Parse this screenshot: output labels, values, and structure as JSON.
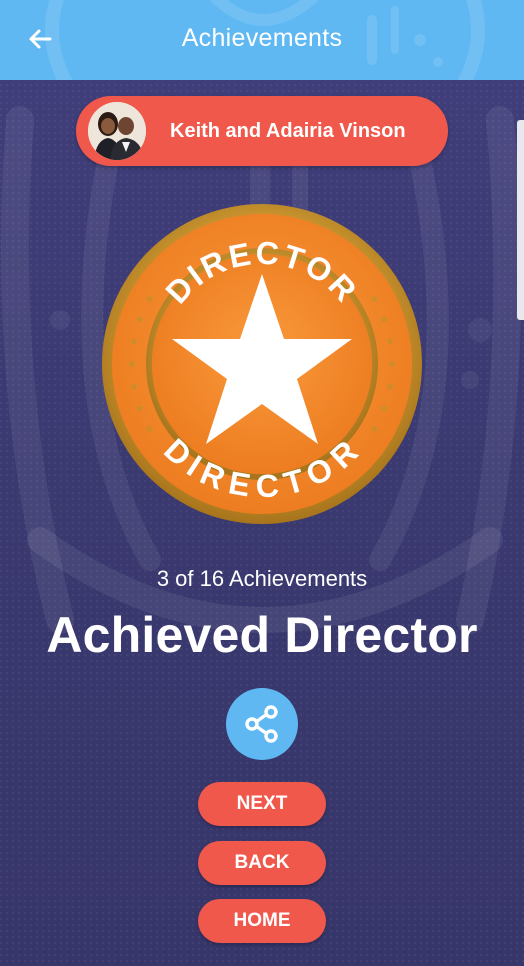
{
  "header": {
    "title": "Achievements",
    "back_icon": "arrow-left-icon",
    "color": "#5fb8f2"
  },
  "user": {
    "name": "Keith and Adairia Vinson",
    "avatar_icon": "couple-photo"
  },
  "badge": {
    "top_text": "DIRECTOR",
    "bottom_text": "DIRECTOR",
    "icon": "star-icon",
    "color": "#f7892a"
  },
  "achievement": {
    "progress_text": "3 of 16 Achievements",
    "title": "Achieved Director"
  },
  "actions": {
    "share_icon": "share-icon",
    "next_label": "NEXT",
    "back_label": "BACK",
    "home_label": "HOME",
    "button_color": "#f1584c"
  }
}
